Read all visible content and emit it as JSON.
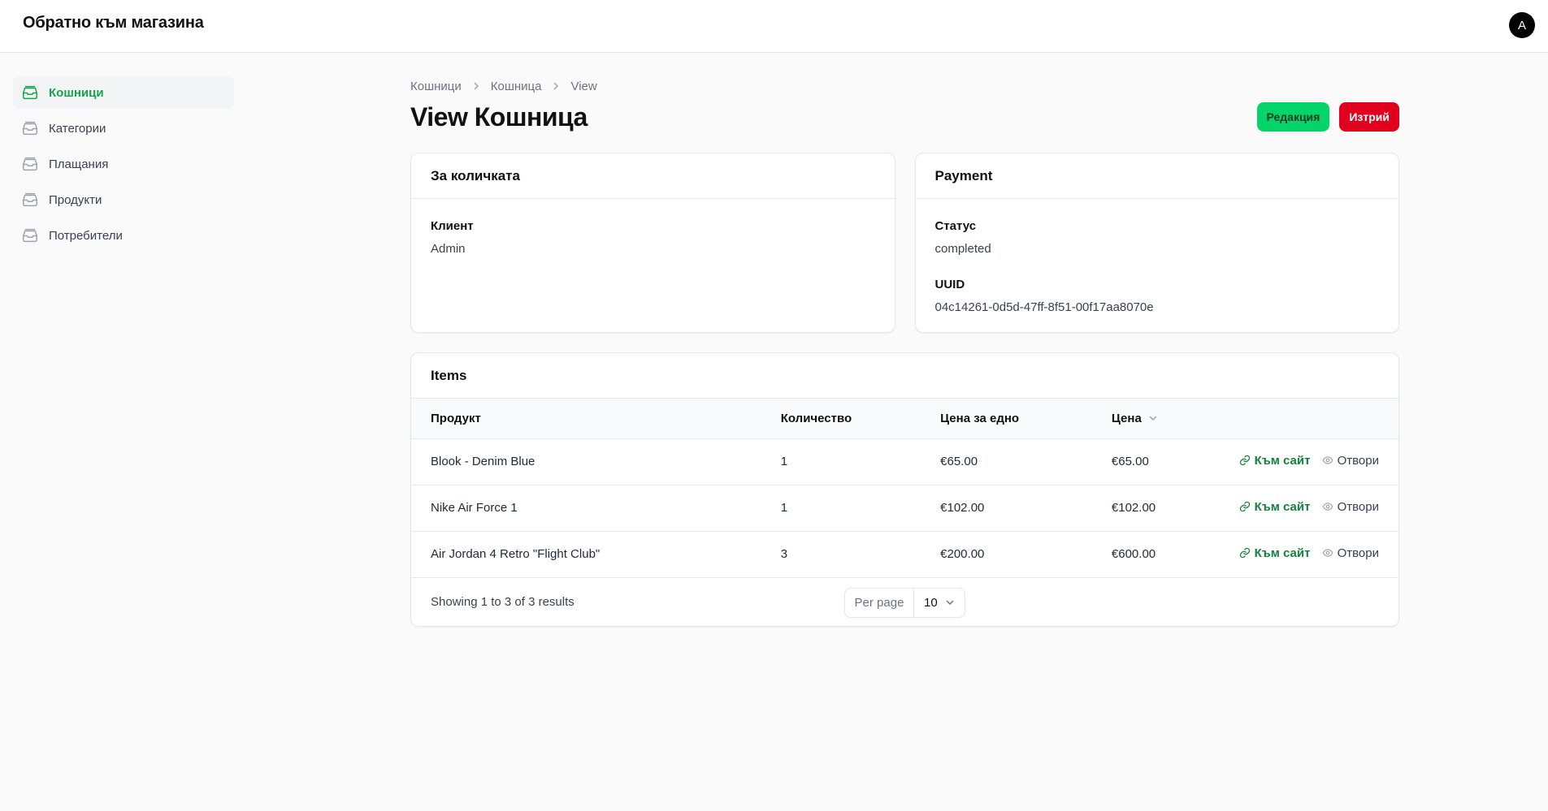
{
  "header": {
    "brand": "Обратно към магазина",
    "avatar_initial": "A"
  },
  "sidebar": {
    "items": [
      {
        "label": "Кошници",
        "active": true
      },
      {
        "label": "Категории",
        "active": false
      },
      {
        "label": "Плащания",
        "active": false
      },
      {
        "label": "Продукти",
        "active": false
      },
      {
        "label": "Потребители",
        "active": false
      }
    ]
  },
  "breadcrumb": [
    "Кошници",
    "Кошница",
    "View"
  ],
  "page": {
    "title": "View Кошница",
    "edit_label": "Редакция",
    "delete_label": "Изтрий"
  },
  "cart_card": {
    "title": "За количката",
    "fields": [
      {
        "label": "Клиент",
        "value": "Admin"
      }
    ]
  },
  "payment_card": {
    "title": "Payment",
    "fields": [
      {
        "label": "Статус",
        "value": "completed"
      },
      {
        "label": "UUID",
        "value": "04c14261-0d5d-47ff-8f51-00f17aa8070e"
      }
    ]
  },
  "items": {
    "title": "Items",
    "columns": {
      "product": "Продукт",
      "quantity": "Количество",
      "unit_price": "Цена за едно",
      "price": "Цена"
    },
    "rows": [
      {
        "product": "Blook - Denim Blue",
        "quantity": "1",
        "unit_price": "€65.00",
        "price": "€65.00",
        "site": "Към сайт",
        "open": "Отвори"
      },
      {
        "product": "Nike Air Force 1",
        "quantity": "1",
        "unit_price": "€102.00",
        "price": "€102.00",
        "site": "Към сайт",
        "open": "Отвори"
      },
      {
        "product": "Air Jordan 4 Retro \"Flight Club\"",
        "quantity": "3",
        "unit_price": "€200.00",
        "price": "€600.00",
        "site": "Към сайт",
        "open": "Отвори"
      }
    ],
    "summary": "Showing 1 to 3 of 3 results",
    "per_page_label": "Per page",
    "per_page_value": "10"
  },
  "colors": {
    "accent": "#16a34a",
    "edit_button": "#04d56b",
    "delete_button": "#e0001e"
  },
  "icons": {
    "nav": "inbox-stack-icon",
    "chevron": "chevron-right-icon",
    "link": "link-icon",
    "eye": "eye-icon",
    "sort": "chevron-down-icon"
  }
}
